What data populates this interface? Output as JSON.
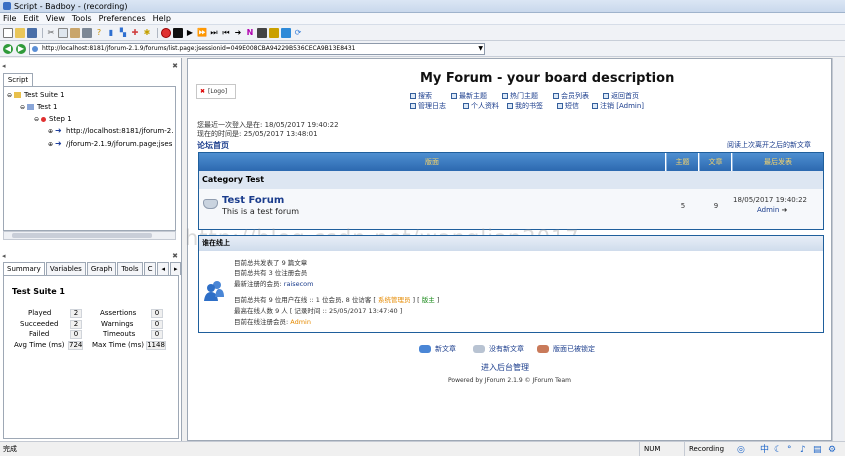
{
  "window": {
    "title": "Script - Badboy - (recording)"
  },
  "menu": [
    "File",
    "Edit",
    "View",
    "Tools",
    "Preferences",
    "Help"
  ],
  "address": {
    "url": "http://localhost:8181/jforum-2.1.9/forums/list.page;jsessionid=049E008CBA94229B536CECA9B13E8431"
  },
  "script_panel": {
    "tab": "Script",
    "tree": [
      {
        "label": "Test Suite 1",
        "level": 0,
        "icon": "folder-icon"
      },
      {
        "label": "Test 1",
        "level": 1,
        "icon": "test-icon"
      },
      {
        "label": "Step 1",
        "level": 2,
        "icon": "step-icon"
      },
      {
        "label": "http://localhost:8181/jforum-2.",
        "level": 3,
        "icon": "request-icon"
      },
      {
        "label": "/jforum-2.1.9/jforum.page;jses",
        "level": 3,
        "icon": "request-icon"
      }
    ]
  },
  "summary_panel": {
    "tabs": [
      "Summary",
      "Variables",
      "Graph",
      "Tools",
      "C"
    ],
    "title": "Test Suite 1",
    "stats": [
      {
        "label": "Played",
        "value": "2"
      },
      {
        "label": "Succeeded",
        "value": "2"
      },
      {
        "label": "Failed",
        "value": "0"
      },
      {
        "label": "Avg Time (ms)",
        "value": "724"
      }
    ],
    "stats_right": [
      {
        "label": "Assertions",
        "value": "0"
      },
      {
        "label": "Warnings",
        "value": "0"
      },
      {
        "label": "Timeouts",
        "value": "0"
      },
      {
        "label": "Max Time (ms)",
        "value": "1148"
      }
    ]
  },
  "forum": {
    "logo_text": "[Logo]",
    "title": "My Forum - your board description",
    "nav_row1": [
      "搜索",
      "最新主题",
      "热门主题",
      "会员列表",
      "返回首页"
    ],
    "nav_row2": [
      "管理日志",
      "个人资料",
      "我的书签",
      "短信",
      "注销 [Admin]"
    ],
    "last_visit": "您最近一次登入是在: 18/05/2017 19:40:22",
    "now_time": "现在的时间是: 25/05/2017 13:48:01",
    "home_label": "论坛首页",
    "read_new": "阅读上次离开之后的新文章",
    "headers": {
      "forum": "版面",
      "topics": "主题",
      "posts": "文章",
      "last": "最后发表"
    },
    "category": "Category Test",
    "forum_row": {
      "name": "Test Forum",
      "desc": "This is a test forum",
      "topics": "5",
      "posts": "9",
      "last_time": "18/05/2017 19:40:22",
      "last_author": "Admin"
    },
    "online": {
      "title": "谁在线上",
      "line1": "目前总共发表了 9 篇文章",
      "line2": "目前总共有 3 位注册会员",
      "line3_prefix": "最新注册的会员: ",
      "line3_user": "raisecom",
      "line4_prefix": "目前总共有 9 位用户在线 :: 1 位会员, 8 位访客 [ ",
      "line4_admin": "系统管理员",
      "line4_mid": " ] [ ",
      "line4_mod": "版主",
      "line4_end": " ]",
      "line5": "最高在线人数 9 人 [ 记录时间 :: 25/05/2017 13:47:40 ]",
      "line6_prefix": "目前在线注册会员: ",
      "line6_user": "Admin"
    },
    "legend": [
      "新文章",
      "没有新文章",
      "版面已被锁定"
    ],
    "admin_link": "进入后台管理",
    "powered": "Powered by JForum 2.1.9 © JForum Team"
  },
  "watermark": "http://blog.csdn.net/wanglian2017",
  "status": {
    "left": "完成",
    "num": "NUM",
    "mode": "Recording"
  },
  "colors": {
    "accent": "#2c69b0",
    "record": "#e03030",
    "link": "#1a3c8c"
  }
}
